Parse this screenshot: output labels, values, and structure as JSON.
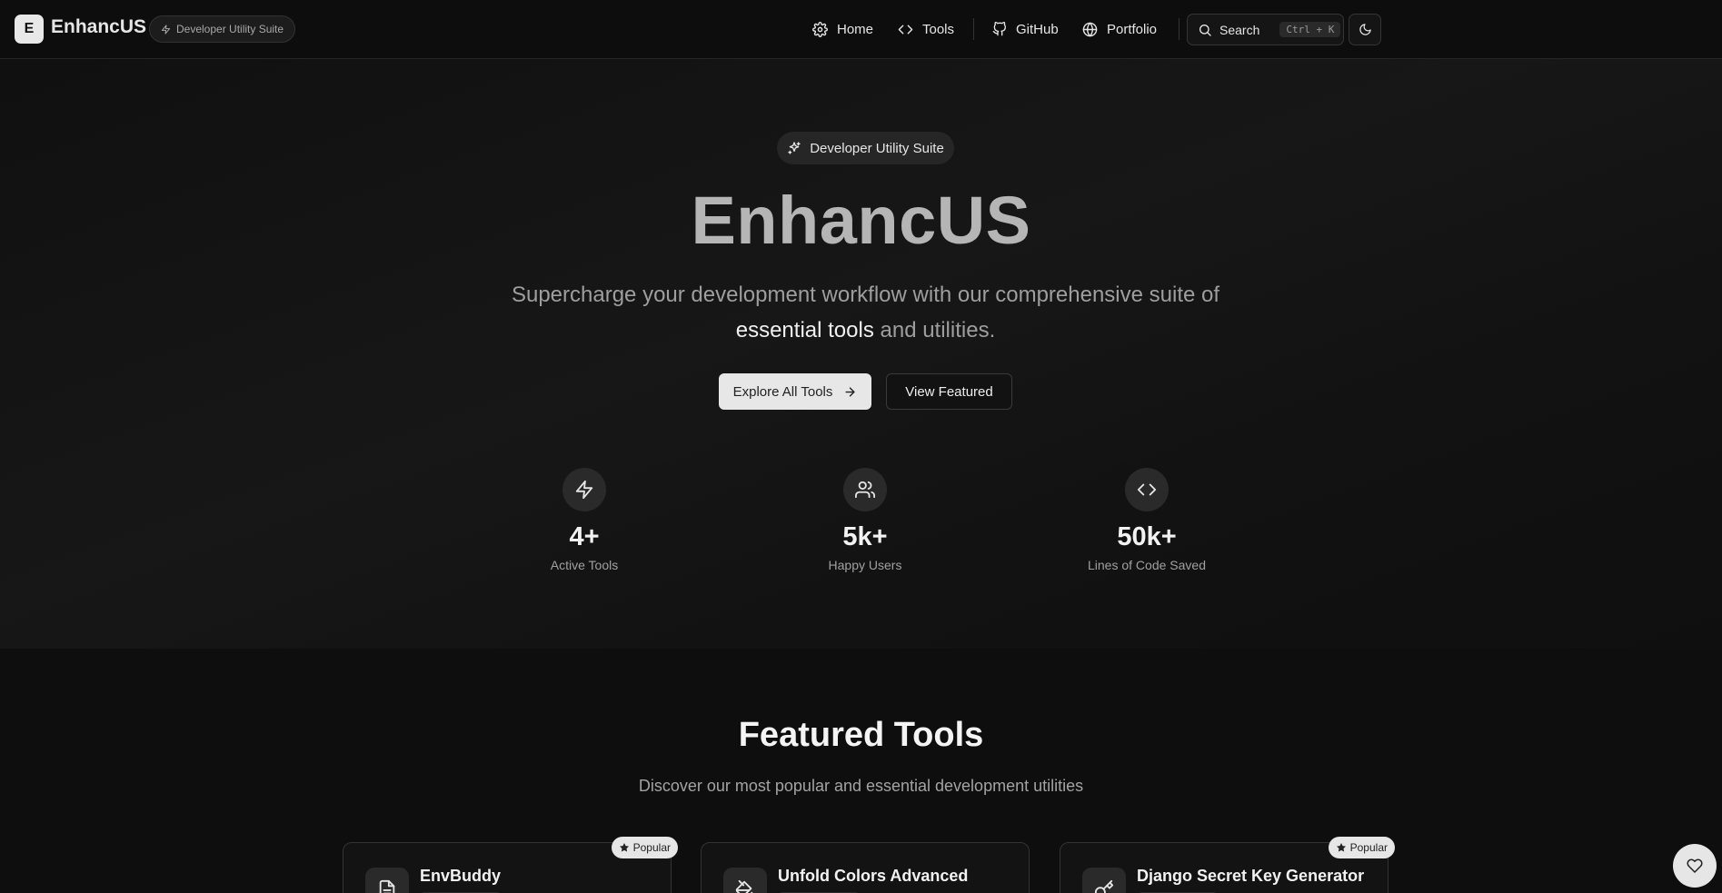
{
  "header": {
    "logo_letter": "E",
    "brand": "EnhancUS",
    "badge": "Developer Utility Suite",
    "nav": [
      {
        "label": "Home",
        "icon": "gear-icon"
      },
      {
        "label": "Tools",
        "icon": "code-icon"
      },
      {
        "label": "GitHub",
        "icon": "github-icon"
      },
      {
        "label": "Portfolio",
        "icon": "globe-icon"
      }
    ],
    "search_label": "Search",
    "search_shortcut": "Ctrl + K",
    "theme_icon": "moon-icon"
  },
  "hero": {
    "pill": "Developer Utility Suite",
    "title": "EnhancUS",
    "subtitle_part1": "Supercharge your development workflow with our comprehensive suite of",
    "subtitle_highlight": "essential tools",
    "subtitle_part2": "and utilities.",
    "primary_button": "Explore All Tools",
    "secondary_button": "View Featured",
    "stats": [
      {
        "value": "4+",
        "label": "Active Tools",
        "icon": "zap-icon"
      },
      {
        "value": "5k+",
        "label": "Happy Users",
        "icon": "users-icon"
      },
      {
        "value": "50k+",
        "label": "Lines of Code Saved",
        "icon": "code-icon"
      }
    ]
  },
  "featured": {
    "title": "Featured Tools",
    "subtitle": "Discover our most popular and essential development utilities",
    "cards": [
      {
        "title": "EnvBuddy",
        "icon": "file-icon",
        "badge": "Popular"
      },
      {
        "title": "Unfold Colors Advanced",
        "icon": "paint-bucket-icon",
        "badge": ""
      },
      {
        "title": "Django Secret Key Generator",
        "icon": "key-icon",
        "badge": "Popular"
      }
    ]
  },
  "colors": {
    "background": "#0e0e0e",
    "accent": "#e7e7e7",
    "title_gray": "#b5b5b5"
  }
}
